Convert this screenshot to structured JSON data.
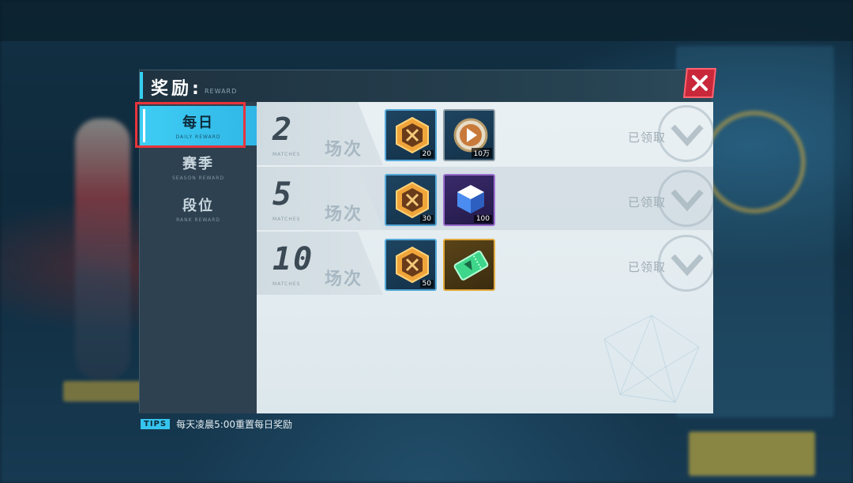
{
  "dialog": {
    "title": "奖励:",
    "subtitle": "REWARD"
  },
  "sidebar": {
    "tabs": [
      {
        "label": "每日",
        "sub": "DAILY REWARD",
        "active": true
      },
      {
        "label": "赛季",
        "sub": "SEASON REWARD",
        "active": false
      },
      {
        "label": "段位",
        "sub": "RANK REWARD",
        "active": false
      }
    ]
  },
  "rewards": [
    {
      "num": "2",
      "unit": "场次",
      "sub": "MATCHES",
      "items": [
        {
          "icon": "hexagon-token-icon",
          "qty": "20",
          "frame": "blue"
        },
        {
          "icon": "coin-icon",
          "qty": "10万",
          "frame": "gray"
        }
      ],
      "status": "已领取"
    },
    {
      "num": "5",
      "unit": "场次",
      "sub": "MATCHES",
      "items": [
        {
          "icon": "hexagon-token-icon",
          "qty": "30",
          "frame": "blue"
        },
        {
          "icon": "cube-icon",
          "qty": "100",
          "frame": "purple"
        }
      ],
      "status": "已领取"
    },
    {
      "num": "10",
      "unit": "场次",
      "sub": "MATCHES",
      "items": [
        {
          "icon": "hexagon-token-icon",
          "qty": "50",
          "frame": "blue"
        },
        {
          "icon": "ticket-icon",
          "qty": "",
          "frame": "gold"
        }
      ],
      "status": "已领取"
    }
  ],
  "tips": {
    "badge": "TIPS",
    "text": "每天凌晨5:00重置每日奖励"
  },
  "colors": {
    "accent": "#35d0f0",
    "close": "#c8283a",
    "highlight": "#e8343c"
  }
}
